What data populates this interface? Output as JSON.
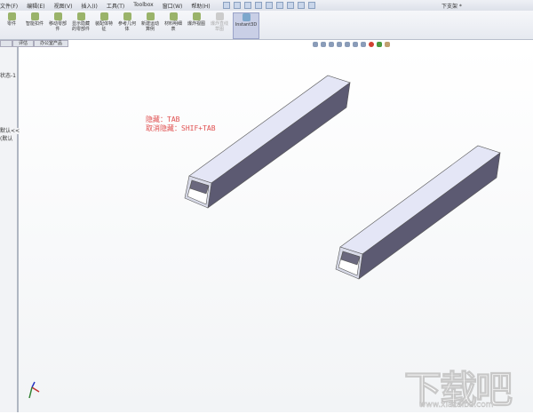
{
  "menu": [
    "文件(F)",
    "编辑(E)",
    "视图(V)",
    "插入(I)",
    "工具(T)",
    "Toolbox",
    "窗口(W)",
    "帮助(H)"
  ],
  "title": "下支架 *",
  "ribbon": [
    "零件",
    "智能扣件",
    "移动零部件",
    "显示隐藏的零部件",
    "装配体特征",
    "参考几何体",
    "新建运动算例",
    "材料明细表",
    "爆炸视图",
    "爆炸直线草图",
    "Instant3D"
  ],
  "tabs": [
    "",
    "评估",
    "办公室产品"
  ],
  "left_panel": {
    "state": "状态-1",
    "default1": "默认<<",
    "default2": "(默认"
  },
  "annotation": {
    "line1": "隐藏：TAB",
    "line2": "取消隐藏：SHIF+TAB"
  },
  "watermark": {
    "logo": "下载吧",
    "url": "www.xiazaiba.com"
  }
}
